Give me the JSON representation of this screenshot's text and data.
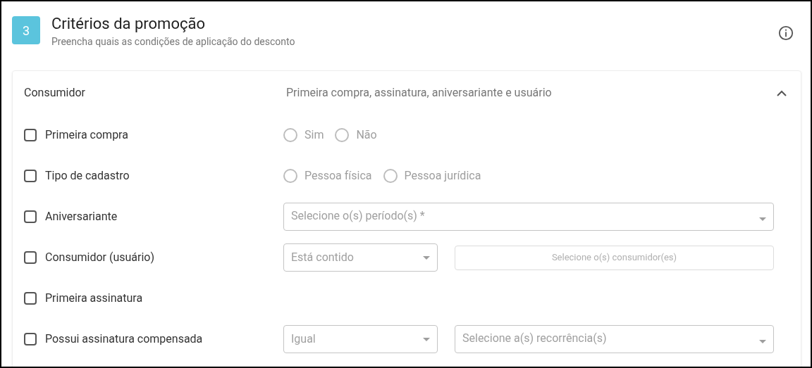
{
  "header": {
    "step": "3",
    "title": "Critérios da promoção",
    "subtitle": "Preencha quais as condições de aplicação do desconto"
  },
  "section": {
    "title": "Consumidor",
    "summary": "Primeira compra, assinatura, aniversariante e usuário",
    "expanded": true,
    "rows": [
      {
        "label": "Primeira compra",
        "checked": false,
        "kind": "radio",
        "options": [
          {
            "label": "Sim",
            "selected": false
          },
          {
            "label": "Não",
            "selected": false
          }
        ]
      },
      {
        "label": "Tipo de cadastro",
        "checked": false,
        "kind": "radio",
        "options": [
          {
            "label": "Pessoa física",
            "selected": false
          },
          {
            "label": "Pessoa jurídica",
            "selected": false
          }
        ]
      },
      {
        "label": "Aniversariante",
        "checked": false,
        "kind": "select",
        "placeholder": "Selecione o(s) período(s) *"
      },
      {
        "label": "Consumidor (usuário)",
        "checked": false,
        "kind": "select_button",
        "value": "Está contido",
        "button": "Selecione o(s) consumidor(es)"
      },
      {
        "label": "Primeira assinatura",
        "checked": false,
        "kind": "none"
      },
      {
        "label": "Possui assinatura compensada",
        "checked": false,
        "kind": "select_select",
        "value": "Igual",
        "placeholder": "Selecione a(s) recorrência(s)"
      }
    ]
  }
}
